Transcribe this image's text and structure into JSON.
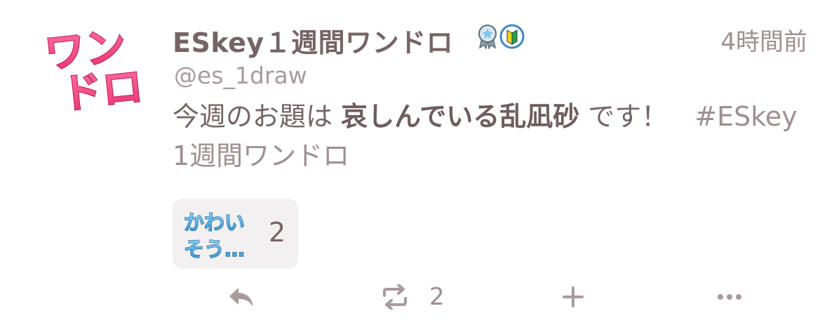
{
  "note": {
    "author": {
      "display_name": "ESkey１週間ワンドロ",
      "username": "@es_1draw",
      "avatar_text": [
        "ワン",
        "ドロ"
      ],
      "badges": [
        "ribbon-badge-icon",
        "beginner-leaf-icon"
      ]
    },
    "timestamp": "4時間前",
    "body": {
      "prefix": "今週のお題は ",
      "bold": "哀しんでいる乱凪砂",
      "suffix": " です！　",
      "hashtag": "#ESkey1週間ワンドロ"
    },
    "reactions": [
      {
        "emoji_text": [
          "かわい",
          "そう…"
        ],
        "count": "2"
      }
    ],
    "actions": {
      "reply_icon": "reply-icon",
      "renote_icon": "renote-icon",
      "renote_count": "2",
      "react_icon": "plus-icon",
      "more_icon": "more-icon"
    }
  },
  "colors": {
    "text_primary": "#756466",
    "text_secondary": "#a89b9d",
    "avatar_pink": "#f0457f",
    "reaction_bg": "#f2f0f0",
    "reaction_blue": "#3aa5dc"
  }
}
